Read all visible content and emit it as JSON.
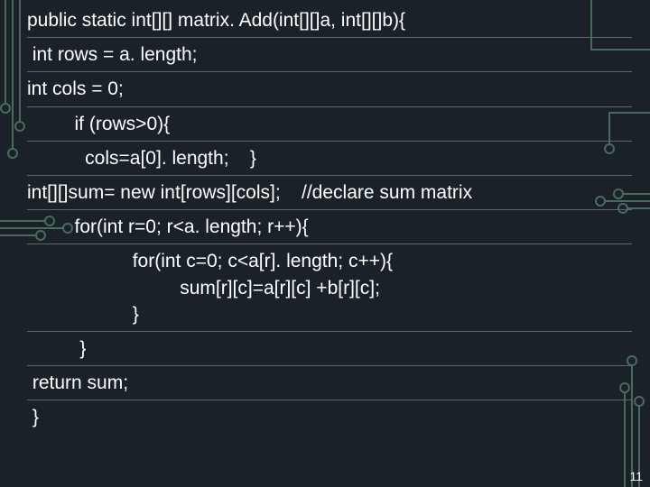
{
  "lines": {
    "l1": "public static int[][] matrix. Add(int[][]a, int[][]b){",
    "l2": " int rows = a. length;",
    "l3": "int cols = 0;",
    "l4": "         if (rows>0){",
    "l5": "           cols=a[0]. length;    }",
    "l6": "int[][]sum= new int[rows][cols];    //declare sum matrix",
    "l7": "         for(int r=0; r<a. length; r++){",
    "l8": "                    for(int c=0; c<a[r]. length; c++){",
    "l9": "                             sum[r][c]=a[r][c] +b[r][c];",
    "l10": "                    }",
    "l11": "          }",
    "l12": " return sum;",
    "l13": " }"
  },
  "pagenum": "11"
}
